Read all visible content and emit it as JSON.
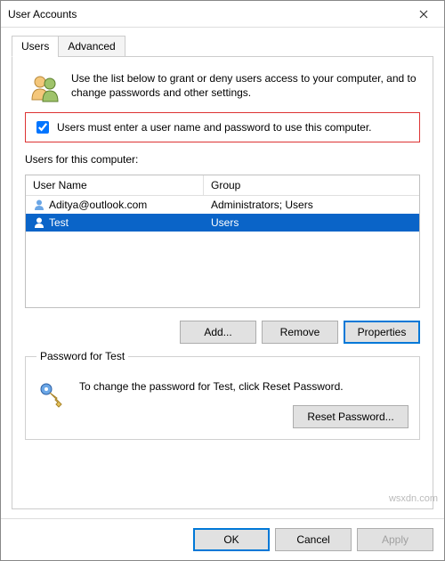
{
  "window": {
    "title": "User Accounts"
  },
  "tabs": {
    "users": "Users",
    "advanced": "Advanced"
  },
  "intro": "Use the list below to grant or deny users access to your computer, and to change passwords and other settings.",
  "must_enter_label": "Users must enter a user name and password to use this computer.",
  "must_enter_checked": true,
  "users_for_label": "Users for this computer:",
  "columns": {
    "name": "User Name",
    "group": "Group"
  },
  "users": [
    {
      "name": "Aditya@outlook.com",
      "group": "Administrators; Users",
      "selected": false
    },
    {
      "name": "Test",
      "group": "Users",
      "selected": true
    }
  ],
  "buttons": {
    "add": "Add...",
    "remove": "Remove",
    "properties": "Properties"
  },
  "password_section": {
    "legend": "Password for Test",
    "text": "To change the password for Test, click Reset Password.",
    "reset": "Reset Password..."
  },
  "dialog_buttons": {
    "ok": "OK",
    "cancel": "Cancel",
    "apply": "Apply"
  },
  "watermark": "wsxdn.com"
}
